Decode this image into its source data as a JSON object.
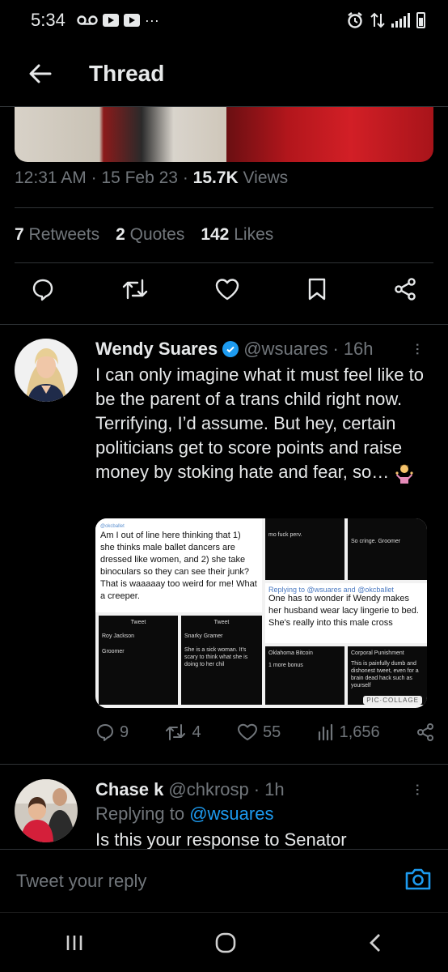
{
  "status_bar": {
    "time": "5:34",
    "notif_icons": [
      "voicemail-icon",
      "youtube-icon",
      "youtube-icon",
      "more-dots-icon"
    ],
    "more": "···"
  },
  "header": {
    "title": "Thread"
  },
  "main_tweet": {
    "time": "12:31 AM",
    "date": "15 Feb 23",
    "views_count": "15.7K",
    "views_label": "Views",
    "retweets_count": "7",
    "retweets_label": "Retweets",
    "quotes_count": "2",
    "quotes_label": "Quotes",
    "likes_count": "142",
    "likes_label": "Likes"
  },
  "replies": [
    {
      "name": "Wendy Suares",
      "handle": "@wsuares",
      "time": "16h",
      "text": "I can only imagine what it must feel like to be the parent of a trans child right now. Terrifying, I’d assume. But hey, certain politicians get to score points and raise money by stoking hate and fear, so…",
      "collage": {
        "quote_text": "Am I out of line here thinking that 1) she thinks male ballet dancers are dressed like women, and 2) she take binoculars so they can see their junk? That is waaaaay too weird for me! What a creeper.",
        "quote_handle": "@okcballet",
        "reply_to": "Replying to @wsuares and @okcballet",
        "reply_text": "One has to wonder if Wendy makes her husband wear lacy lingerie to bed. She's really into this male cross",
        "small_1": "mo fuck perv.",
        "small_2": "So cringe. Groomer",
        "small_3": "Groomer",
        "small_4": "She is a sick woman. It's scary to think what she is doing to her chil",
        "small_5": "1 more bonus",
        "small_6": "This is painfully dumb and dishonest tweet, even for a brain dead hack such as yourself",
        "small_name_1": "Roy Jackson",
        "small_name_2": "Snarky Gramer",
        "small_name_3": "Oklahoma Bitcoin",
        "small_name_4": "Corporal Punishment",
        "screen_title": "Tweet",
        "watermark": "PIC·COLLAGE"
      },
      "replies_count": "9",
      "retweets_count": "4",
      "likes_count": "55",
      "views_count": "1,656"
    },
    {
      "name": "Chase k",
      "handle": "@chkrosp",
      "time": "1h",
      "replying_label": "Replying to",
      "replying_to": "@wsuares",
      "text": "Is this your response to Senator"
    }
  ],
  "composer": {
    "placeholder": "Tweet your reply"
  },
  "colors": {
    "accent": "#1d9bf0",
    "background": "#000000",
    "secondary_text": "#71767b"
  }
}
